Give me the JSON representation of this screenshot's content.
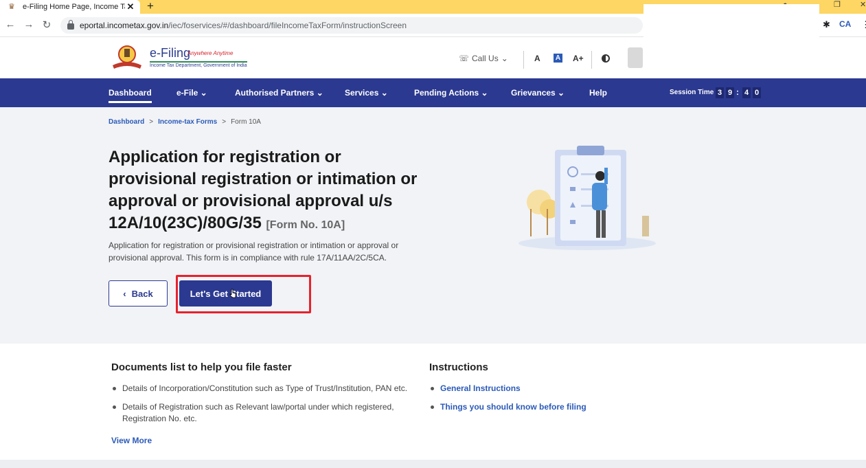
{
  "browser": {
    "tab_title": "e-Filing Home Page, Income Tax",
    "tab_close": "✕",
    "new_tab": "+",
    "url_host": "eportal.incometax.gov.in",
    "url_path": "/iec/foservices/#/dashboard/fileIncomeTaxForm/instructionScreen"
  },
  "header": {
    "logo_title": "e-Filing",
    "logo_tagline": "Anywhere Anytime",
    "logo_subtitle": "Income Tax Department, Government of India",
    "call_us": "Call Us",
    "font_decrease": "A",
    "font_normal": "A",
    "font_increase": "A+"
  },
  "nav": {
    "items": [
      {
        "label": "Dashboard"
      },
      {
        "label": "e-File ⌄"
      },
      {
        "label": "Authorised Partners ⌄"
      },
      {
        "label": "Services ⌄"
      },
      {
        "label": "Pending Actions ⌄"
      },
      {
        "label": "Grievances ⌄"
      },
      {
        "label": "Help"
      }
    ],
    "session_label": "Session Time",
    "session_digits": [
      "3",
      "9",
      "4",
      "0"
    ]
  },
  "breadcrumb": {
    "items": [
      "Dashboard",
      "Income-tax Forms",
      "Form 10A"
    ],
    "separator": ">"
  },
  "hero": {
    "title": "Application for registration or provisional registration or intimation or approval or provisional approval u/s 12A/10(23C)/80G/35",
    "form_no": "[Form No. 10A]",
    "description": "Application for registration or provisional registration or intimation or approval or provisional approval. This form is in compliance with rule 17A/11AA/2C/5CA.",
    "back_label": "Back",
    "start_label": "Let's Get Started"
  },
  "documents": {
    "heading": "Documents list to help you file faster",
    "items": [
      "Details of Incorporation/Constitution such as Type of Trust/Institution, PAN etc.",
      "Details of Registration such as Relevant law/portal under which registered, Registration No. etc."
    ],
    "view_more": "View More"
  },
  "instructions": {
    "heading": "Instructions",
    "links": [
      "General Instructions",
      "Things you should know before filing"
    ]
  },
  "colors": {
    "nav_bg": "#2b3990",
    "hero_bg": "#f1f3f6",
    "highlight": "#e8212b",
    "link": "#2b5ab8"
  }
}
